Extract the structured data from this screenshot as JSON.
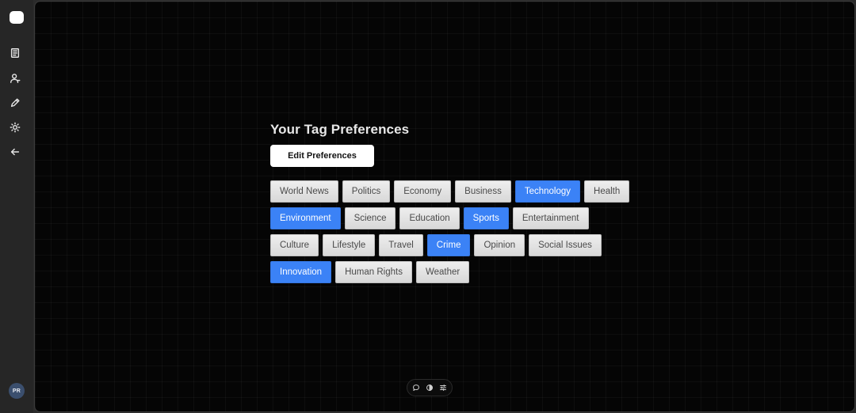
{
  "sidebar": {
    "items": [
      {
        "icon": "book-icon"
      },
      {
        "icon": "user-icon"
      },
      {
        "icon": "pencil-icon"
      },
      {
        "icon": "sun-icon"
      },
      {
        "icon": "arrow-left-icon"
      }
    ],
    "avatar_initials": "PR"
  },
  "main": {
    "title": "Your Tag Preferences",
    "edit_button_label": "Edit Preferences",
    "tag_rows": [
      [
        {
          "label": "World News",
          "selected": false
        },
        {
          "label": "Politics",
          "selected": false
        },
        {
          "label": "Economy",
          "selected": false
        },
        {
          "label": "Business",
          "selected": false
        },
        {
          "label": "Technology",
          "selected": true
        },
        {
          "label": "Health",
          "selected": false
        }
      ],
      [
        {
          "label": "Environment",
          "selected": true
        },
        {
          "label": "Science",
          "selected": false
        },
        {
          "label": "Education",
          "selected": false
        },
        {
          "label": "Sports",
          "selected": true
        },
        {
          "label": "Entertainment",
          "selected": false
        }
      ],
      [
        {
          "label": "Culture",
          "selected": false
        },
        {
          "label": "Lifestyle",
          "selected": false
        },
        {
          "label": "Travel",
          "selected": false
        },
        {
          "label": "Crime",
          "selected": true
        },
        {
          "label": "Opinion",
          "selected": false
        },
        {
          "label": "Social Issues",
          "selected": false
        }
      ],
      [
        {
          "label": "Innovation",
          "selected": true
        },
        {
          "label": "Human Rights",
          "selected": false
        },
        {
          "label": "Weather",
          "selected": false
        }
      ]
    ]
  },
  "bottom_bar": {
    "icons": [
      "chat-icon",
      "contrast-icon",
      "sliders-icon"
    ]
  },
  "colors": {
    "selected_tag": "#3b82f6",
    "unselected_tag": "#e3e3e3",
    "canvas_background": "#050505"
  }
}
